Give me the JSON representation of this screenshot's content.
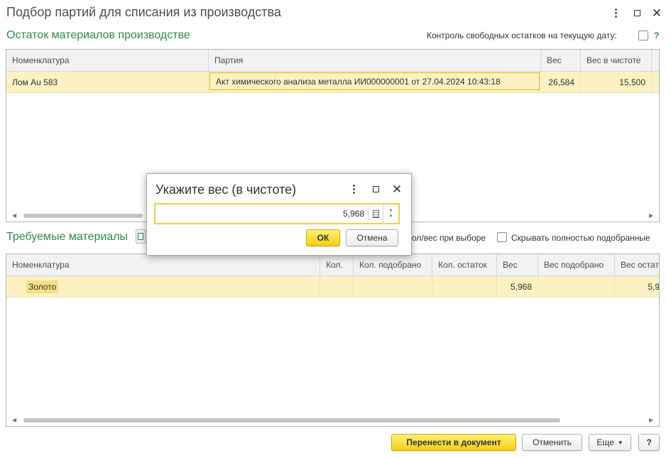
{
  "window": {
    "title": "Подбор партий для списания из производства",
    "more_icon": "more-vertical-icon",
    "maximize_icon": "maximize-icon",
    "close_icon": "close-icon"
  },
  "stock": {
    "title": "Остаток материалов  производстве",
    "control_label": "Контроль свободных остатков на текущую дату:",
    "control_checked": false,
    "help": "?",
    "columns": [
      "Номенклатура",
      "Партия",
      "Вес",
      "Вес в чистоте"
    ],
    "rows": [
      {
        "nomenclature": "Лом Au 583",
        "batch": "Акт химического анализа металла ИИ000000001 от 27.04.2024 10:43:18",
        "weight": "26,584",
        "weight_pure": "15,500"
      }
    ]
  },
  "required": {
    "title": "Требуемые материалы",
    "partial_label": "ол/вес при выборе",
    "hide_label": "Скрывать полностью подобранные",
    "hide_checked": false,
    "columns": [
      "Номенклатура",
      "Кол.",
      "Кол. подобрано",
      "Кол. остаток",
      "Вес",
      "Вес подобрано",
      "Вес остат"
    ],
    "rows": [
      {
        "nomenclature": "Золото",
        "qty": "",
        "qty_selected": "",
        "qty_rest": "",
        "weight": "5,968",
        "weight_selected": "",
        "weight_rest": "5,9"
      }
    ]
  },
  "dialog": {
    "title": "Укажите вес (в чистоте)",
    "value": "5,968",
    "ok": "ОК",
    "cancel": "Отмена"
  },
  "footer": {
    "transfer": "Перенести в документ",
    "cancel": "Отменить",
    "more": "Еще",
    "help": "?"
  },
  "colors": {
    "accent_green": "#2a8c4a",
    "selection_yellow": "#fbf1c3",
    "button_yellow": "#f5cf10"
  }
}
